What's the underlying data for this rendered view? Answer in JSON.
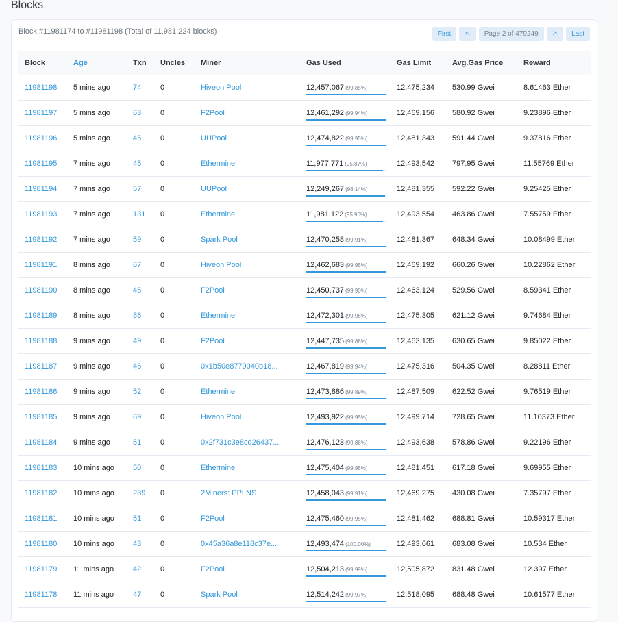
{
  "page": {
    "title": "Blocks"
  },
  "summary": "Block #11981174 to #11981198 (Total of 11,981,224 blocks)",
  "pager": {
    "first": "First",
    "prev": "<",
    "info": "Page 2 of 479249",
    "next": ">",
    "last": "Last"
  },
  "columns": [
    "Block",
    "Age",
    "Txn",
    "Uncles",
    "Miner",
    "Gas Used",
    "Gas Limit",
    "Avg.Gas Price",
    "Reward"
  ],
  "colors": {
    "link": "#3498db",
    "bar": "#3498db"
  },
  "rows": [
    {
      "block": "11981198",
      "age": "5 mins ago",
      "txn": "74",
      "uncles": "0",
      "miner": "Hiveon Pool",
      "gas_used": "12,457,067",
      "gas_pct": "(99.85%)",
      "gas_fraction": 0.9985,
      "gas_limit": "12,475,234",
      "avg_gas_price": "530.99 Gwei",
      "reward": "8.61463 Ether"
    },
    {
      "block": "11981197",
      "age": "5 mins ago",
      "txn": "63",
      "uncles": "0",
      "miner": "F2Pool",
      "gas_used": "12,461,292",
      "gas_pct": "(99.94%)",
      "gas_fraction": 0.9994,
      "gas_limit": "12,469,156",
      "avg_gas_price": "580.92 Gwei",
      "reward": "9.23896 Ether"
    },
    {
      "block": "11981196",
      "age": "5 mins ago",
      "txn": "45",
      "uncles": "0",
      "miner": "UUPool",
      "gas_used": "12,474,822",
      "gas_pct": "(99.95%)",
      "gas_fraction": 0.9995,
      "gas_limit": "12,481,343",
      "avg_gas_price": "591.44 Gwei",
      "reward": "9.37816 Ether"
    },
    {
      "block": "11981195",
      "age": "7 mins ago",
      "txn": "45",
      "uncles": "0",
      "miner": "Ethermine",
      "gas_used": "11,977,771",
      "gas_pct": "(95.87%)",
      "gas_fraction": 0.9587,
      "gas_limit": "12,493,542",
      "avg_gas_price": "797.95 Gwei",
      "reward": "11.55769 Ether"
    },
    {
      "block": "11981194",
      "age": "7 mins ago",
      "txn": "57",
      "uncles": "0",
      "miner": "UUPool",
      "gas_used": "12,249,267",
      "gas_pct": "(98.14%)",
      "gas_fraction": 0.9814,
      "gas_limit": "12,481,355",
      "avg_gas_price": "592.22 Gwei",
      "reward": "9.25425 Ether"
    },
    {
      "block": "11981193",
      "age": "7 mins ago",
      "txn": "131",
      "uncles": "0",
      "miner": "Ethermine",
      "gas_used": "11,981,122",
      "gas_pct": "(95.90%)",
      "gas_fraction": 0.959,
      "gas_limit": "12,493,554",
      "avg_gas_price": "463.86 Gwei",
      "reward": "7.55759 Ether"
    },
    {
      "block": "11981192",
      "age": "7 mins ago",
      "txn": "59",
      "uncles": "0",
      "miner": "Spark Pool",
      "gas_used": "12,470,258",
      "gas_pct": "(99.91%)",
      "gas_fraction": 0.9991,
      "gas_limit": "12,481,367",
      "avg_gas_price": "648.34 Gwei",
      "reward": "10.08499 Ether"
    },
    {
      "block": "11981191",
      "age": "8 mins ago",
      "txn": "67",
      "uncles": "0",
      "miner": "Hiveon Pool",
      "gas_used": "12,462,683",
      "gas_pct": "(99.95%)",
      "gas_fraction": 0.9995,
      "gas_limit": "12,469,192",
      "avg_gas_price": "660.26 Gwei",
      "reward": "10.22862 Ether"
    },
    {
      "block": "11981190",
      "age": "8 mins ago",
      "txn": "45",
      "uncles": "0",
      "miner": "F2Pool",
      "gas_used": "12,450,737",
      "gas_pct": "(99.90%)",
      "gas_fraction": 0.999,
      "gas_limit": "12,463,124",
      "avg_gas_price": "529.56 Gwei",
      "reward": "8.59341 Ether"
    },
    {
      "block": "11981189",
      "age": "8 mins ago",
      "txn": "86",
      "uncles": "0",
      "miner": "Ethermine",
      "gas_used": "12,472,301",
      "gas_pct": "(99.98%)",
      "gas_fraction": 0.9998,
      "gas_limit": "12,475,305",
      "avg_gas_price": "621.12 Gwei",
      "reward": "9.74684 Ether"
    },
    {
      "block": "11981188",
      "age": "9 mins ago",
      "txn": "49",
      "uncles": "0",
      "miner": "F2Pool",
      "gas_used": "12,447,735",
      "gas_pct": "(99.88%)",
      "gas_fraction": 0.9988,
      "gas_limit": "12,463,135",
      "avg_gas_price": "630.65 Gwei",
      "reward": "9.85022 Ether"
    },
    {
      "block": "11981187",
      "age": "9 mins ago",
      "txn": "46",
      "uncles": "0",
      "miner": "0x1b50e8779040b18...",
      "gas_used": "12,467,819",
      "gas_pct": "(99.94%)",
      "gas_fraction": 0.9994,
      "gas_limit": "12,475,316",
      "avg_gas_price": "504.35 Gwei",
      "reward": "8.28811 Ether"
    },
    {
      "block": "11981186",
      "age": "9 mins ago",
      "txn": "52",
      "uncles": "0",
      "miner": "Ethermine",
      "gas_used": "12,473,886",
      "gas_pct": "(99.89%)",
      "gas_fraction": 0.9989,
      "gas_limit": "12,487,509",
      "avg_gas_price": "622.52 Gwei",
      "reward": "9.76519 Ether"
    },
    {
      "block": "11981185",
      "age": "9 mins ago",
      "txn": "69",
      "uncles": "0",
      "miner": "Hiveon Pool",
      "gas_used": "12,493,922",
      "gas_pct": "(99.95%)",
      "gas_fraction": 0.9995,
      "gas_limit": "12,499,714",
      "avg_gas_price": "728.65 Gwei",
      "reward": "11.10373 Ether"
    },
    {
      "block": "11981184",
      "age": "9 mins ago",
      "txn": "51",
      "uncles": "0",
      "miner": "0x2f731c3e8cd26437...",
      "gas_used": "12,476,123",
      "gas_pct": "(99.86%)",
      "gas_fraction": 0.9986,
      "gas_limit": "12,493,638",
      "avg_gas_price": "578.86 Gwei",
      "reward": "9.22196 Ether"
    },
    {
      "block": "11981183",
      "age": "10 mins ago",
      "txn": "50",
      "uncles": "0",
      "miner": "Ethermine",
      "gas_used": "12,475,404",
      "gas_pct": "(99.95%)",
      "gas_fraction": 0.9995,
      "gas_limit": "12,481,451",
      "avg_gas_price": "617.18 Gwei",
      "reward": "9.69955 Ether"
    },
    {
      "block": "11981182",
      "age": "10 mins ago",
      "txn": "239",
      "uncles": "0",
      "miner": "2Miners: PPLNS",
      "gas_used": "12,458,043",
      "gas_pct": "(99.91%)",
      "gas_fraction": 0.9991,
      "gas_limit": "12,469,275",
      "avg_gas_price": "430.08 Gwei",
      "reward": "7.35797 Ether"
    },
    {
      "block": "11981181",
      "age": "10 mins ago",
      "txn": "51",
      "uncles": "0",
      "miner": "F2Pool",
      "gas_used": "12,475,460",
      "gas_pct": "(99.95%)",
      "gas_fraction": 0.9995,
      "gas_limit": "12,481,462",
      "avg_gas_price": "688.81 Gwei",
      "reward": "10.59317 Ether"
    },
    {
      "block": "11981180",
      "age": "10 mins ago",
      "txn": "43",
      "uncles": "0",
      "miner": "0x45a36a8e118c37e...",
      "gas_used": "12,493,474",
      "gas_pct": "(100.00%)",
      "gas_fraction": 1.0,
      "gas_limit": "12,493,661",
      "avg_gas_price": "683.08 Gwei",
      "reward": "10.534 Ether"
    },
    {
      "block": "11981179",
      "age": "11 mins ago",
      "txn": "42",
      "uncles": "0",
      "miner": "F2Pool",
      "gas_used": "12,504,213",
      "gas_pct": "(99.99%)",
      "gas_fraction": 0.9999,
      "gas_limit": "12,505,872",
      "avg_gas_price": "831.48 Gwei",
      "reward": "12.397 Ether"
    },
    {
      "block": "11981178",
      "age": "11 mins ago",
      "txn": "47",
      "uncles": "0",
      "miner": "Spark Pool",
      "gas_used": "12,514,242",
      "gas_pct": "(99.97%)",
      "gas_fraction": 0.9997,
      "gas_limit": "12,518,095",
      "avg_gas_price": "688.48 Gwei",
      "reward": "10.61577 Ether"
    }
  ]
}
